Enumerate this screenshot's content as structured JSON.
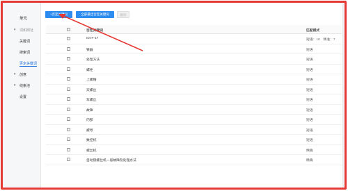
{
  "sidebar": {
    "unit": "单元",
    "group_title": "词和网址",
    "sub_items": [
      "关键词",
      "搜索词",
      "否定关键词"
    ],
    "collapsible": [
      {
        "label": "创意"
      },
      {
        "label": "线索池"
      }
    ],
    "settings": "设置"
  },
  "toolbar": {
    "add_negative": "+否定关键词",
    "batch_add": "全部最佳否定关键词",
    "delete": "删除"
  },
  "table": {
    "headers": {
      "keyword": "否定关键词",
      "match": "匹配模式"
    },
    "rows": [
      {
        "keyword": "ID:IF-17",
        "match": "短语：10　精准：7"
      },
      {
        "keyword": "铁器",
        "match": "短语"
      },
      {
        "keyword": "处理方法",
        "match": "短语"
      },
      {
        "keyword": "螺栓",
        "match": "短语"
      },
      {
        "keyword": "上螺帽",
        "match": "短语"
      },
      {
        "keyword": "双螺丝",
        "match": "短语"
      },
      {
        "keyword": "车螺丝",
        "match": "短语"
      },
      {
        "keyword": "故障",
        "match": "短语"
      },
      {
        "keyword": "内部",
        "match": "短语"
      },
      {
        "keyword": "螺母",
        "match": "短语"
      },
      {
        "keyword": "数控机",
        "match": "短语"
      },
      {
        "keyword": "螺丝机",
        "match": "精确"
      },
      {
        "keyword": "自动锁螺丝机一般故障及处理办法",
        "match": "精确"
      }
    ]
  },
  "colors": {
    "annotation": "#e53935",
    "primary": "#2d8cf0"
  }
}
